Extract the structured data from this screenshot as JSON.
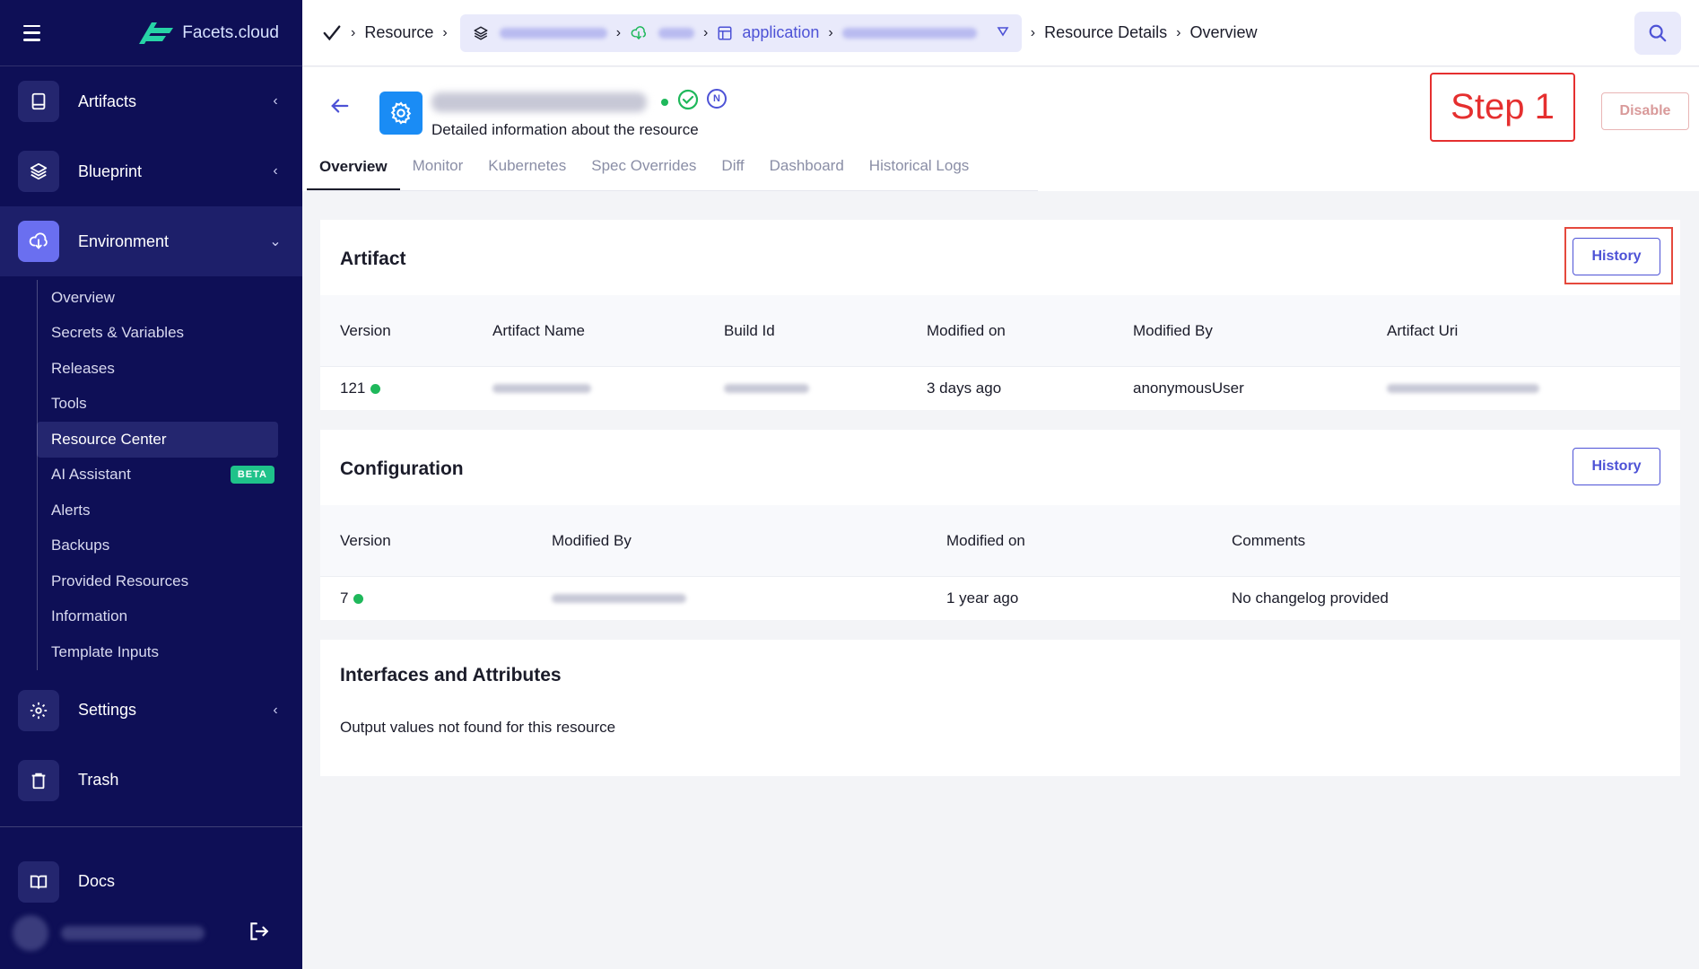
{
  "sidebar": {
    "brand": "Facets.cloud",
    "groups": [
      {
        "label": "Artifacts"
      },
      {
        "label": "Blueprint"
      },
      {
        "label": "Environment"
      }
    ],
    "env_items": [
      {
        "label": "Overview"
      },
      {
        "label": "Secrets & Variables"
      },
      {
        "label": "Releases"
      },
      {
        "label": "Tools"
      },
      {
        "label": "Resource Center"
      },
      {
        "label": "AI Assistant",
        "badge": "BETA"
      },
      {
        "label": "Alerts"
      },
      {
        "label": "Backups"
      },
      {
        "label": "Provided Resources"
      },
      {
        "label": "Information"
      },
      {
        "label": "Template Inputs"
      }
    ],
    "lower_groups": [
      {
        "label": "Settings"
      },
      {
        "label": "Trash"
      }
    ],
    "docs": "Docs"
  },
  "topbar": {
    "crumb_resource": "Resource",
    "crumb_application": "application",
    "crumb_details": "Resource Details",
    "crumb_overview": "Overview"
  },
  "header": {
    "subtitle": "Detailed information about the resource",
    "status_badge": "N",
    "step_label": "Step 1",
    "disable_label": "Disable",
    "tabs": [
      "Overview",
      "Monitor",
      "Kubernetes",
      "Spec Overrides",
      "Diff",
      "Dashboard",
      "Historical Logs"
    ]
  },
  "artifact": {
    "title": "Artifact",
    "history_label": "History",
    "columns": [
      "Version",
      "Artifact Name",
      "Build Id",
      "Modified on",
      "Modified By",
      "Artifact Uri"
    ],
    "row": {
      "version": "121",
      "modified_on": "3 days ago",
      "modified_by": "anonymousUser"
    }
  },
  "configuration": {
    "title": "Configuration",
    "history_label": "History",
    "columns": [
      "Version",
      "Modified By",
      "Modified on",
      "Comments"
    ],
    "row": {
      "version": "7",
      "modified_on": "1 year ago",
      "comments": "No changelog provided"
    }
  },
  "interfaces": {
    "title": "Interfaces and Attributes",
    "message": "Output values not found for this resource"
  },
  "colors": {
    "sidebar_bg": "#0e0f56",
    "accent": "#4d52d6",
    "highlight": "#e52f2f",
    "status_green": "#1fb85b"
  }
}
